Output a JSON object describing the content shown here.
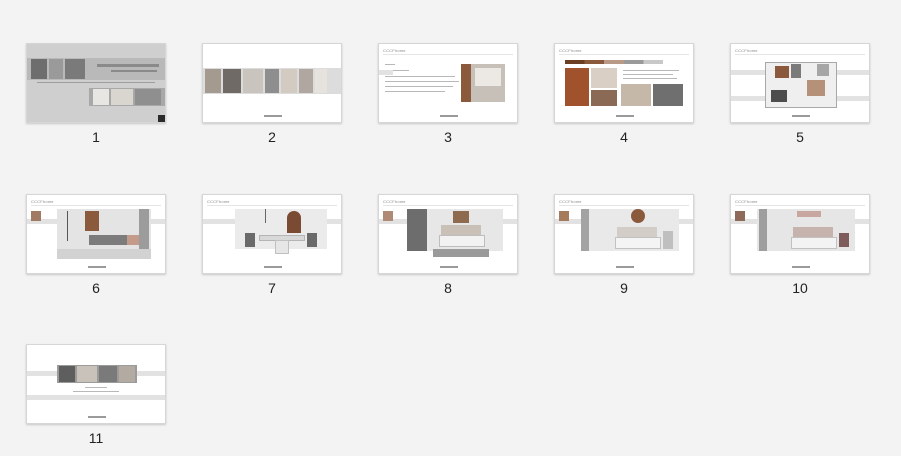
{
  "slides": [
    {
      "number": "1"
    },
    {
      "number": "2"
    },
    {
      "number": "3",
      "header": "CCCFhome"
    },
    {
      "number": "4",
      "header": "CCCFhome"
    },
    {
      "number": "5",
      "header": "CCCFhome"
    },
    {
      "number": "6",
      "header": "CCCFhome"
    },
    {
      "number": "7",
      "header": "CCCFhome"
    },
    {
      "number": "8",
      "header": "CCCFhome"
    },
    {
      "number": "9",
      "header": "CCCFhome"
    },
    {
      "number": "10",
      "header": "CCCFhome"
    },
    {
      "number": "11"
    }
  ],
  "colors": {
    "background": "#f3f3f3",
    "thumbnail_border": "#d6d6d6",
    "cover_gray": "#cfcfcf",
    "accent_wood": "#8b5a3c"
  }
}
